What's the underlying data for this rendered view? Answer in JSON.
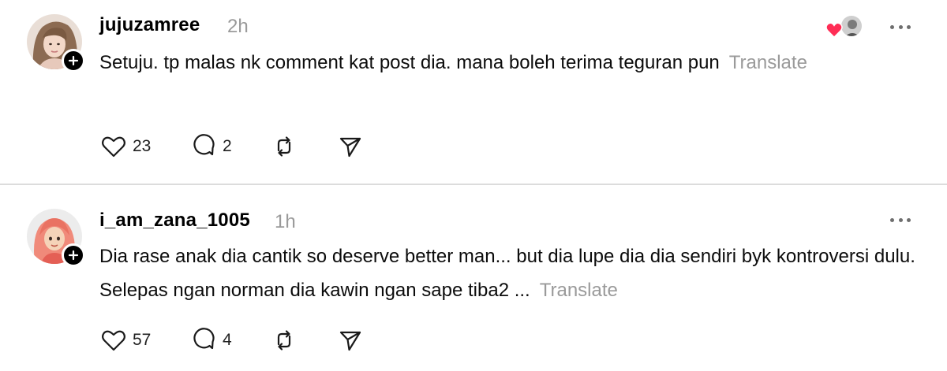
{
  "posts": [
    {
      "username": "jujuzamree",
      "time": "2h",
      "text": "Setuju. tp malas nk comment kat post dia. mana boleh terima teguran pun",
      "translate_label": "Translate",
      "likes": "23",
      "replies": "2",
      "liked_by_icon": "red-heart-icon"
    },
    {
      "username": "i_am_zana_1005",
      "time": "1h",
      "text": "Dia rase anak dia cantik so deserve better man... but dia lupe dia dia sendiri byk kontroversi dulu. Selepas ngan norman dia kawin ngan sape tiba2 ...",
      "translate_label": "Translate",
      "likes": "57",
      "replies": "4"
    }
  ],
  "icons": {
    "like": "heart-outline-icon",
    "reply": "speech-bubble-icon",
    "repost": "repost-arrows-icon",
    "share": "send-paper-plane-icon",
    "more": "more-dots-icon",
    "follow": "plus-icon"
  },
  "colors": {
    "muted_text": "#9a9a9a",
    "heart_red": "#ff2d55",
    "divider": "#dcdcdc"
  }
}
